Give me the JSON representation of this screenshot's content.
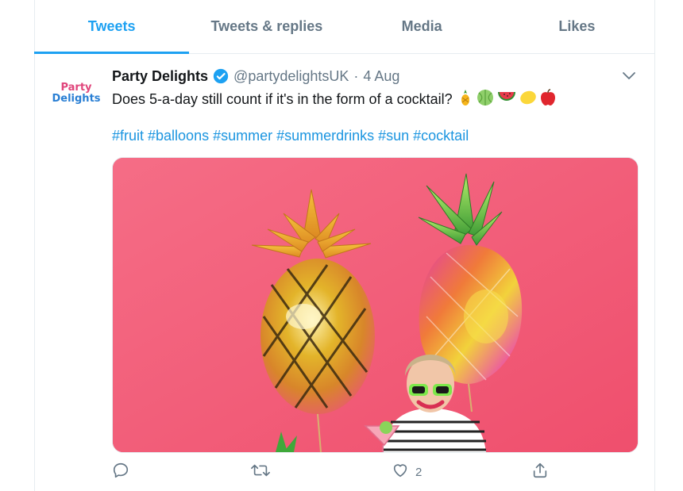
{
  "tabs": [
    {
      "label": "Tweets",
      "active": true
    },
    {
      "label": "Tweets & replies",
      "active": false
    },
    {
      "label": "Media",
      "active": false
    },
    {
      "label": "Likes",
      "active": false
    }
  ],
  "tweet": {
    "avatar_text_line1": "Party",
    "avatar_text_line2": "Delights",
    "display_name": "Party Delights",
    "verified": true,
    "handle": "@partydelightsUK",
    "separator": "·",
    "date": "4 Aug",
    "text": "Does 5-a-day still count if it's in the form of a cocktail?",
    "emojis": [
      "pineapple-emoji",
      "melon-emoji",
      "watermelon-emoji",
      "lemon-emoji",
      "apple-emoji"
    ],
    "hashtags": "#fruit #balloons #summer #summerdrinks #sun #cocktail",
    "media": {
      "description_icon": "photo-pineapple-balloons"
    },
    "actions": {
      "reply_count": "",
      "retweet_count": "",
      "like_count": "2",
      "share_count": ""
    }
  },
  "colors": {
    "accent": "#1da1f2",
    "link": "#1b95e0",
    "muted": "#657786",
    "photo_bg": "#f2617b"
  }
}
